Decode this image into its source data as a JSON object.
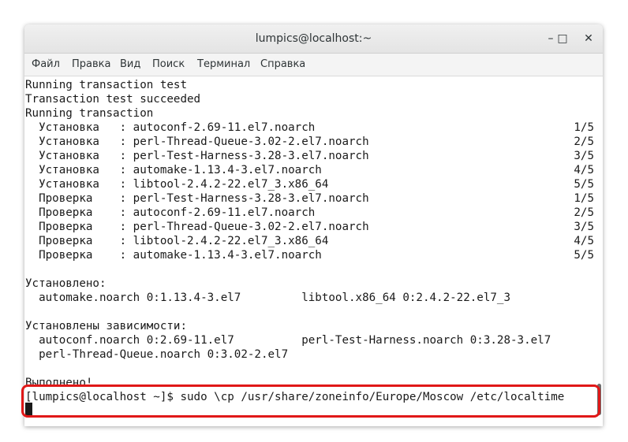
{
  "window": {
    "title": "lumpics@localhost:~",
    "buttons": {
      "minimize": "–",
      "maximize": "□",
      "close": "✕"
    }
  },
  "menu": [
    "Файл",
    "Правка",
    "Вид",
    "Поиск",
    "Терминал",
    "Справка"
  ],
  "terminal": {
    "header_lines": [
      "Running transaction test",
      "Transaction test succeeded",
      "Running transaction"
    ],
    "transaction_rows": [
      {
        "text": "  Установка   : autoconf-2.69-11.el7.noarch",
        "progress": "1/5"
      },
      {
        "text": "  Установка   : perl-Thread-Queue-3.02-2.el7.noarch",
        "progress": "2/5"
      },
      {
        "text": "  Установка   : perl-Test-Harness-3.28-3.el7.noarch",
        "progress": "3/5"
      },
      {
        "text": "  Установка   : automake-1.13.4-3.el7.noarch",
        "progress": "4/5"
      },
      {
        "text": "  Установка   : libtool-2.4.2-22.el7_3.x86_64",
        "progress": "5/5"
      },
      {
        "text": "  Проверка    : perl-Test-Harness-3.28-3.el7.noarch",
        "progress": "1/5"
      },
      {
        "text": "  Проверка    : autoconf-2.69-11.el7.noarch",
        "progress": "2/5"
      },
      {
        "text": "  Проверка    : perl-Thread-Queue-3.02-2.el7.noarch",
        "progress": "3/5"
      },
      {
        "text": "  Проверка    : libtool-2.4.2-22.el7_3.x86_64",
        "progress": "4/5"
      },
      {
        "text": "  Проверка    : automake-1.13.4-3.el7.noarch",
        "progress": "5/5"
      }
    ],
    "installed_heading": "Установлено:",
    "installed_line": "  automake.noarch 0:1.13.4-3.el7         libtool.x86_64 0:2.4.2-22.el7_3",
    "deps_heading": "Установлены зависимости:",
    "deps_line_1": "  autoconf.noarch 0:2.69-11.el7          perl-Test-Harness.noarch 0:3.28-3.el7",
    "deps_line_2": "  perl-Thread-Queue.noarch 0:3.02-2.el7",
    "done": "Выполнено!",
    "prompt_line": "[lumpics@localhost ~]$ sudo \\cp /usr/share/zoneinfo/Europe/Moscow /etc/localtime"
  },
  "colors": {
    "highlight": "#e01818",
    "text": "#1a1a1a",
    "background": "#ffffff"
  }
}
